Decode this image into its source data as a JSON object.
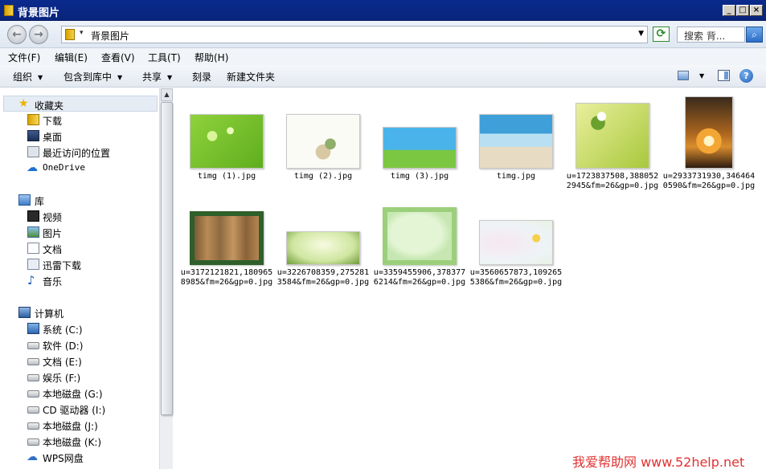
{
  "window": {
    "title": "背景图片"
  },
  "address": {
    "path": "背景图片",
    "search_placeholder": "搜索 背..."
  },
  "menu": [
    "文件(F)",
    "编辑(E)",
    "查看(V)",
    "工具(T)",
    "帮助(H)"
  ],
  "toolbar": {
    "organize": "组织",
    "include_library": "包含到库中",
    "share": "共享",
    "burn": "刻录",
    "new_folder": "新建文件夹"
  },
  "nav": {
    "favorites": {
      "label": "收藏夹",
      "items": [
        "下载",
        "桌面",
        "最近访问的位置",
        "OneDrive"
      ]
    },
    "libraries": {
      "label": "库",
      "items": [
        "视频",
        "图片",
        "文档",
        "迅雷下载",
        "音乐"
      ]
    },
    "computer": {
      "label": "计算机",
      "items": [
        "系统 (C:)",
        "软件 (D:)",
        "文档 (E:)",
        "娱乐 (F:)",
        "本地磁盘 (G:)",
        "CD 驱动器 (I:)",
        "本地磁盘 (J:)",
        "本地磁盘 (K:)",
        "WPS网盘"
      ]
    }
  },
  "files": [
    {
      "name": "timg (1).jpg"
    },
    {
      "name": "timg (2).jpg"
    },
    {
      "name": "timg (3).jpg"
    },
    {
      "name": "timg.jpg"
    },
    {
      "name": "u=1723837508,3880522945&fm=26&gp=0.jpg"
    },
    {
      "name": "u=2933731930,3464640590&fm=26&gp=0.jpg"
    },
    {
      "name": "u=3172121821,1809658985&fm=26&gp=0.jpg"
    },
    {
      "name": "u=3226708359,2752813584&fm=26&gp=0.jpg"
    },
    {
      "name": "u=3359455906,3783776214&fm=26&gp=0.jpg"
    },
    {
      "name": "u=3560657873,1092655386&fm=26&gp=0.jpg"
    }
  ],
  "watermark": "我爱帮助网 www.52help.net"
}
